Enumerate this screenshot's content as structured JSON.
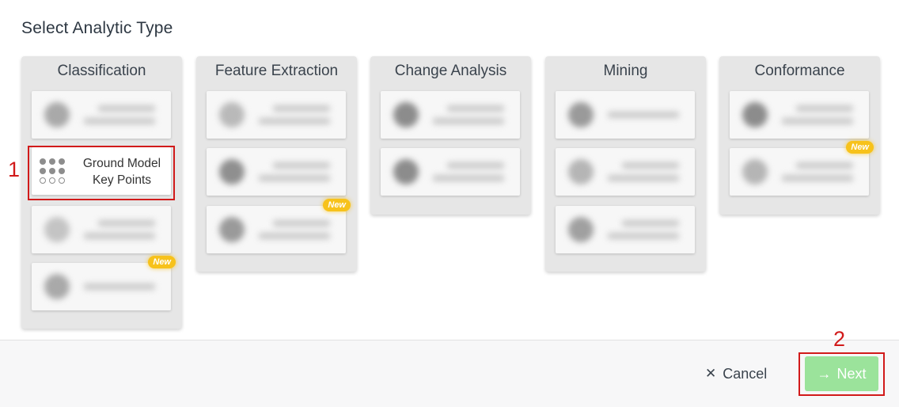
{
  "page_title": "Select Analytic Type",
  "columns": [
    {
      "title": "Classification"
    },
    {
      "title": "Feature Extraction"
    },
    {
      "title": "Change Analysis"
    },
    {
      "title": "Mining"
    },
    {
      "title": "Conformance"
    }
  ],
  "featured_card": {
    "label_line1": "Ground Model",
    "label_line2": "Key Points",
    "icon": "grid-dots-icon"
  },
  "badges": {
    "new": "New"
  },
  "annotations": {
    "step1": "1",
    "step2": "2"
  },
  "footer": {
    "cancel_label": "Cancel",
    "next_label": "Next"
  },
  "colors": {
    "accent_next": "#9be39b",
    "badge": "#f7c21b",
    "highlight": "#d11a1a"
  }
}
